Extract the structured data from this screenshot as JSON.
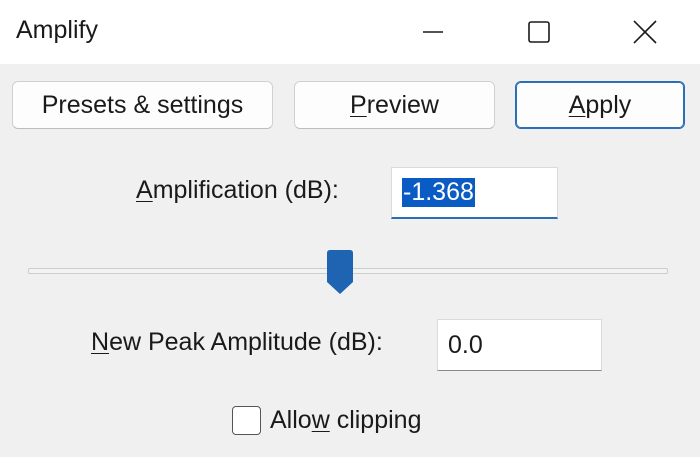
{
  "window": {
    "title": "Amplify",
    "controls": {
      "minimize": "minimize",
      "maximize": "maximize",
      "close": "close"
    }
  },
  "toolbar": {
    "presets_label": "Presets & settings",
    "preview_prefix": "",
    "preview_mnemonic": "P",
    "preview_rest": "review",
    "apply_prefix": "",
    "apply_mnemonic": "A",
    "apply_rest": "pply"
  },
  "amplification": {
    "label_mnemonic": "A",
    "label_rest": "mplification (dB):",
    "value": "-1.368",
    "value_selected": true
  },
  "slider": {
    "level_fraction": 0.488
  },
  "new_peak": {
    "label_mnemonic": "N",
    "label_rest": "ew Peak Amplitude (dB):",
    "value": "0.0"
  },
  "clipping": {
    "label_prefix": "Allo",
    "label_mnemonic": "w",
    "label_rest": " clipping",
    "checked": false
  },
  "colors": {
    "accent": "#2a6fb5",
    "selection": "#0a5cc4",
    "thumb": "#1f63b3"
  }
}
